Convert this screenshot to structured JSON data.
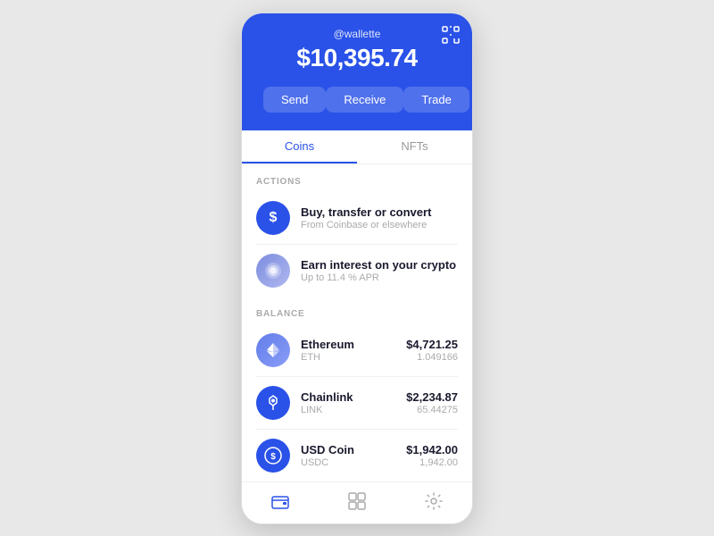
{
  "header": {
    "username": "@wallette",
    "balance": "$10,395.74",
    "scan_label": "scan"
  },
  "action_buttons": [
    {
      "label": "Send",
      "key": "send"
    },
    {
      "label": "Receive",
      "key": "receive"
    },
    {
      "label": "Trade",
      "key": "trade"
    }
  ],
  "tabs": [
    {
      "label": "Coins",
      "active": true
    },
    {
      "label": "NFTs",
      "active": false
    }
  ],
  "actions_section": {
    "section_label": "ACTIONS",
    "items": [
      {
        "title": "Buy, transfer or convert",
        "subtitle": "From Coinbase or elsewhere",
        "icon": "$",
        "icon_type": "blue"
      },
      {
        "title": "Earn interest on your crypto",
        "subtitle": "Up to 11.4 % APR",
        "icon": "●",
        "icon_type": "purple_gradient"
      }
    ]
  },
  "balance_section": {
    "section_label": "BALANCE",
    "items": [
      {
        "name": "Ethereum",
        "symbol": "ETH",
        "value": "$4,721.25",
        "units": "1.049166",
        "icon_type": "eth"
      },
      {
        "name": "Chainlink",
        "symbol": "LINK",
        "value": "$2,234.87",
        "units": "65.44275",
        "icon_type": "link"
      },
      {
        "name": "USD Coin",
        "symbol": "USDC",
        "value": "$1,942.00",
        "units": "1,942.00",
        "icon_type": "usdc"
      }
    ]
  },
  "bottom_nav": [
    {
      "label": "wallet",
      "active": true
    },
    {
      "label": "grid"
    },
    {
      "label": "settings"
    }
  ]
}
